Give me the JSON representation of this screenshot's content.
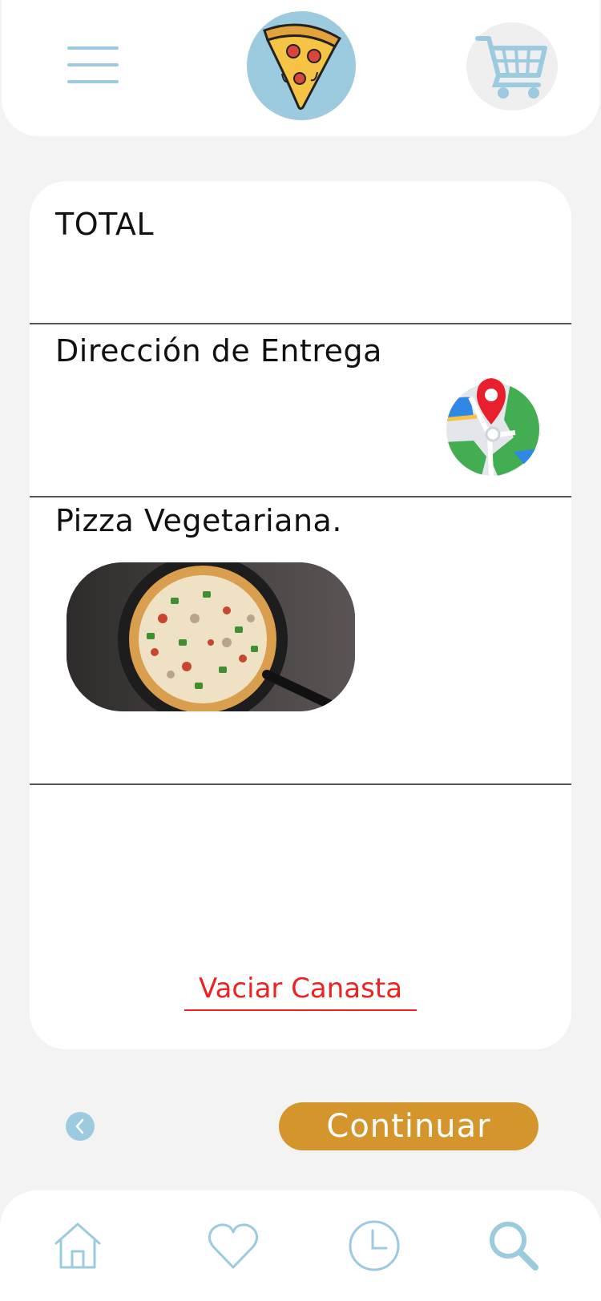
{
  "header": {
    "menu_icon": "hamburger-menu-icon",
    "logo": "pizza-slice-logo",
    "cart_icon": "shopping-cart-icon"
  },
  "card": {
    "total_label": "TOTAL",
    "delivery_label": "Dirección de Entrega",
    "map_icon": "map-location-pin-icon",
    "item_name": "Pizza Vegetariana.",
    "empty_basket_label": "Vaciar Canasta"
  },
  "actions": {
    "back_icon": "chevron-left-icon",
    "continue_label": "Continuar"
  },
  "bottom_nav": {
    "items": [
      {
        "icon": "home-icon"
      },
      {
        "icon": "heart-icon"
      },
      {
        "icon": "clock-icon"
      },
      {
        "icon": "search-icon"
      }
    ]
  },
  "colors": {
    "background": "#f3f3f3",
    "accent_blue": "#9ccade",
    "continue_orange": "#d4952c",
    "danger_red": "#ee2222"
  }
}
